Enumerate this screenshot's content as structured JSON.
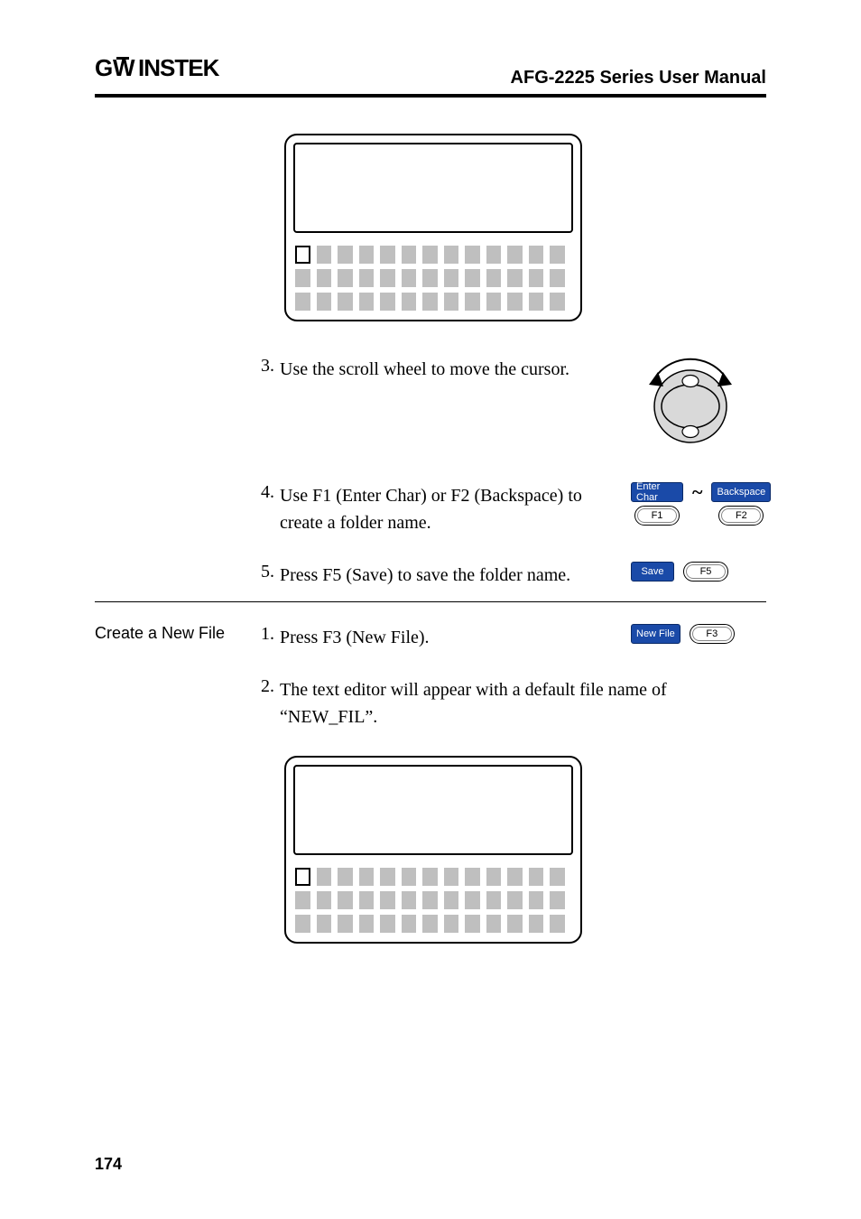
{
  "header": {
    "brand": "GWINSTEK",
    "doc_title": "AFG-2225 Series User Manual"
  },
  "steps_a": [
    {
      "num": "3.",
      "text": "Use the scroll wheel to move the cursor."
    },
    {
      "num": "4.",
      "text": "Use F1 (Enter Char) or F2 (Backspace) to create a folder name."
    },
    {
      "num": "5.",
      "text": "Press F5 (Save) to save the folder name."
    }
  ],
  "section_b": {
    "heading": "Create a New File",
    "steps": [
      {
        "num": "1.",
        "text": "Press F3 (New File)."
      },
      {
        "num": "2.",
        "text": "The text editor will appear with a default file name of “NEW_FIL”."
      }
    ]
  },
  "keys": {
    "enter_char": "Enter Char",
    "backspace": "Backspace",
    "f1": "F1",
    "f2": "F2",
    "save": "Save",
    "f5": "F5",
    "new_file": "New File",
    "f3": "F3"
  },
  "page_number": "174"
}
